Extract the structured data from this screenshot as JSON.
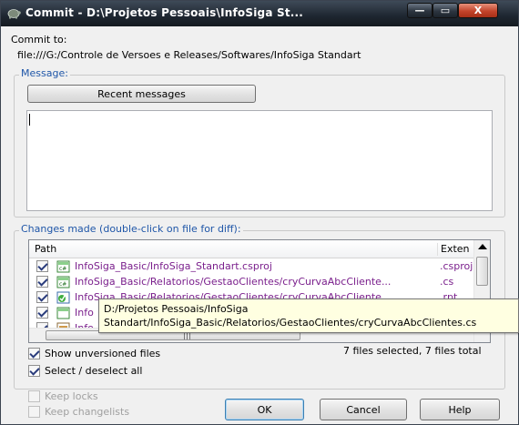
{
  "window": {
    "title": "Commit - D:\\Projetos Pessoais\\InfoSiga St...",
    "min_label": "—",
    "max_label": "▭",
    "close_label": "X"
  },
  "commit_to": {
    "label": "Commit to:",
    "url": "file:///G:/Controle de Versoes e Releases/Softwares/InfoSiga Standart"
  },
  "message": {
    "legend": "Message:",
    "recent_button": "Recent messages",
    "text": ""
  },
  "changes": {
    "legend": "Changes made (double-click on file for diff):",
    "columns": {
      "path": "Path",
      "extension": "Exten"
    },
    "rows": [
      {
        "checked": true,
        "path": "InfoSiga_Basic/InfoSiga_Standart.csproj",
        "ext": ".csproj",
        "icon": "modified-file-icon"
      },
      {
        "checked": true,
        "path": "InfoSiga_Basic/Relatorios/GestaoClientes/cryCurvaAbcCliente...",
        "ext": ".cs",
        "icon": "modified-file-icon"
      },
      {
        "checked": true,
        "path": "InfoSiga_Basic/Relatorios/GestaoClientes/cryCurvaAbcCliente...",
        "ext": ".rpt",
        "icon": "added-file-icon"
      },
      {
        "checked": true,
        "path": "Info",
        "ext": "",
        "icon": "modified-file-icon"
      },
      {
        "checked": true,
        "path": "Info",
        "ext": "",
        "icon": "file-icon"
      }
    ],
    "tooltip_line1": "D:/Projetos Pessoais/InfoSiga",
    "tooltip_line2": "Standart/InfoSiga_Basic/Relatorios/GestaoClientes/cryCurvaAbcClientes.cs",
    "status": "7 files selected, 7 files total"
  },
  "options": {
    "show_unversioned": {
      "label": "Show unversioned files",
      "checked": true
    },
    "select_all": {
      "label": "Select / deselect all",
      "checked": true
    },
    "keep_locks": {
      "label": "Keep locks",
      "checked": false
    },
    "keep_changelists": {
      "label": "Keep changelists",
      "checked": false
    }
  },
  "buttons": {
    "ok": "OK",
    "cancel": "Cancel",
    "help": "Help"
  },
  "colors": {
    "legend": "#1f56a8",
    "modified_path": "#7a1f8c",
    "titlebar": "#1e2630"
  }
}
